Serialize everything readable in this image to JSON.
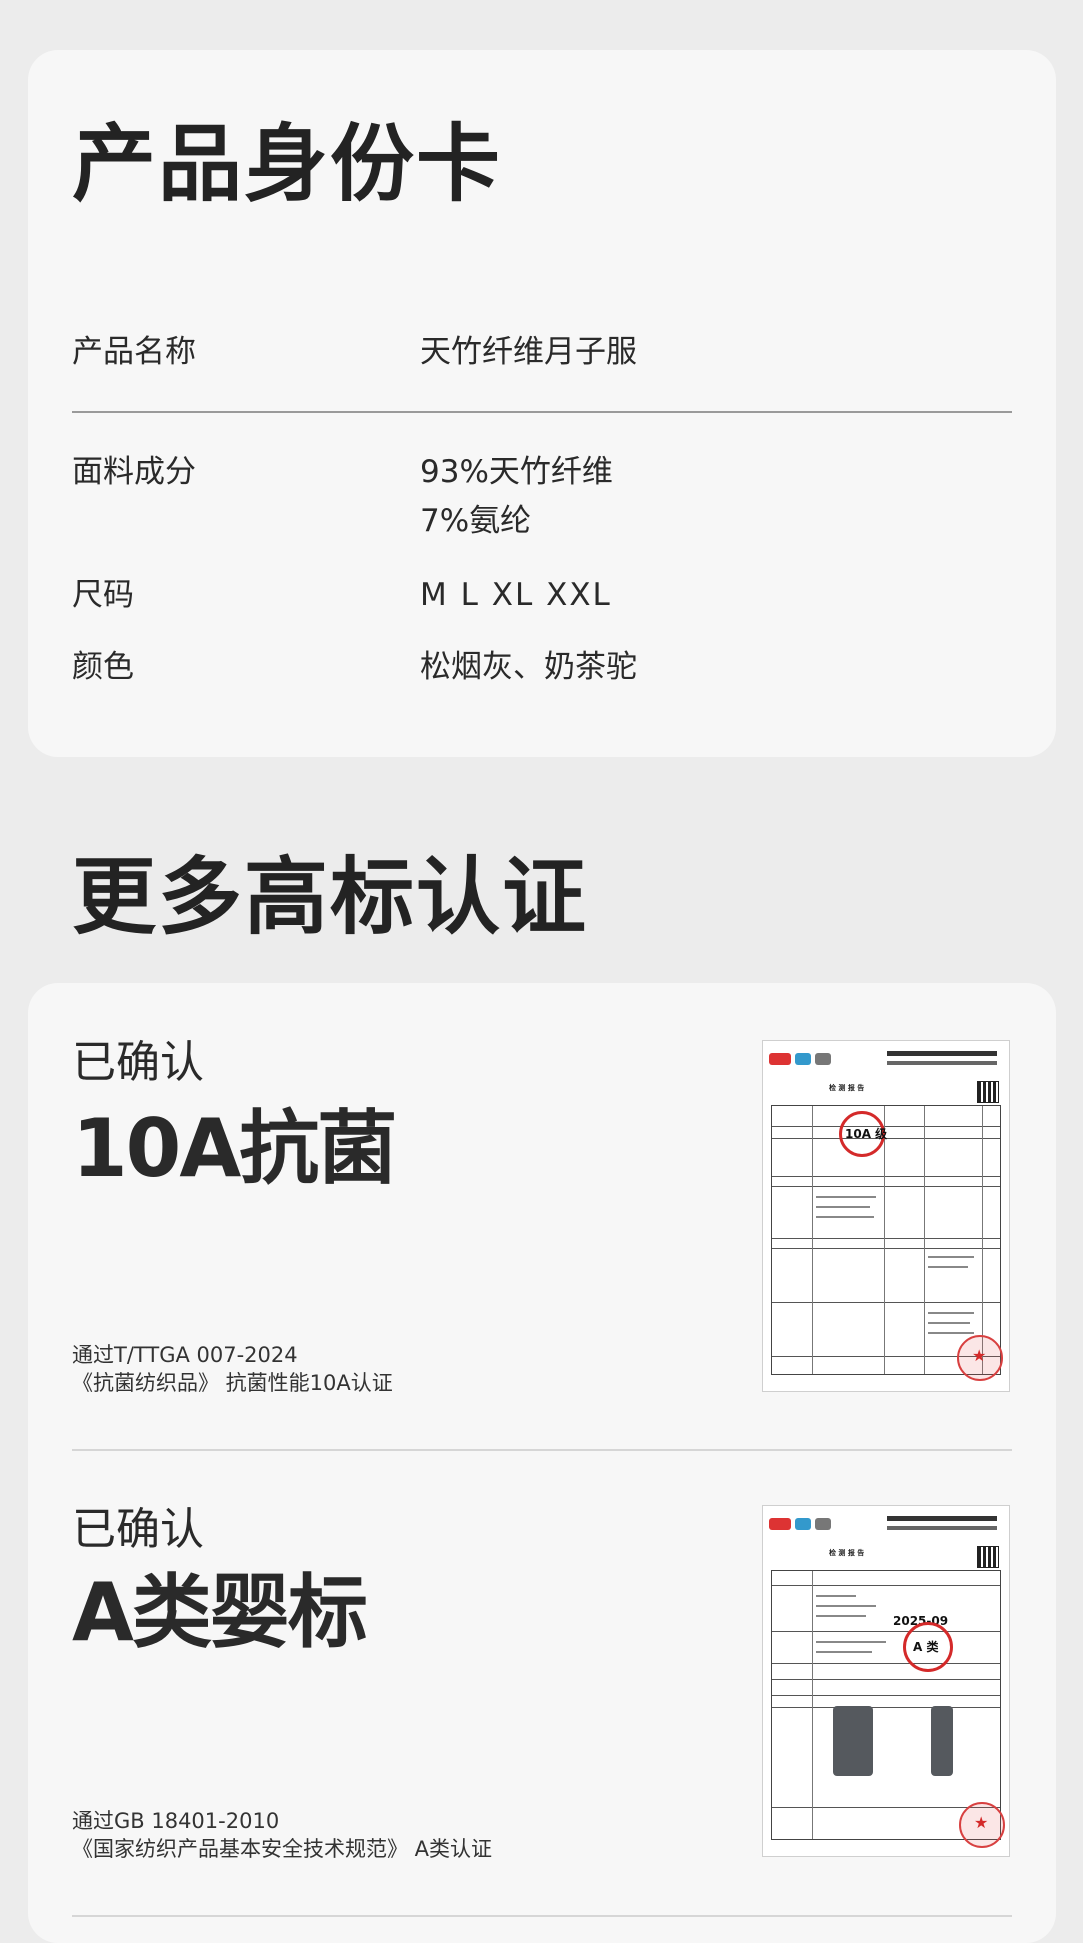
{
  "product_card": {
    "title": "产品身份卡",
    "rows": [
      {
        "label": "产品名称",
        "value": "天竹纤维月子服"
      },
      {
        "label": "面料成分",
        "value_line1": "93%天竹纤维",
        "value_line2": "7%氨纶"
      },
      {
        "label": "尺码",
        "value": "M L XL XXL"
      },
      {
        "label": "颜色",
        "value": "松烟灰、奶茶驼"
      }
    ]
  },
  "more_certs": {
    "title": "更多高标认证",
    "items": [
      {
        "pre": "已确认",
        "main": "10A抗菌",
        "note_line1": "通过T/TTGA 007-2024",
        "note_line2": "《抗菌纺织品》 抗菌性能10A认证",
        "report": {
          "caption": "检 测 报 告",
          "stamp_text": "10A 级"
        }
      },
      {
        "pre": "已确认",
        "main": "A类婴标",
        "note_line1": "通过GB 18401-2010",
        "note_line2": "《国家纺织产品基本安全技术规范》 A类认证",
        "report": {
          "caption": "检 测 报 告",
          "stamp_text": "A 类",
          "date_text": "2025-09"
        }
      }
    ]
  },
  "colors": {
    "page_bg": "#ececec",
    "card_bg": "#f7f7f7",
    "stamp_red": "#d42a2a"
  }
}
